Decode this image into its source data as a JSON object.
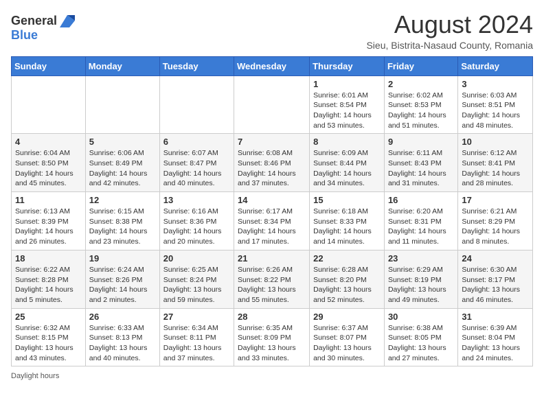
{
  "header": {
    "logo_general": "General",
    "logo_blue": "Blue",
    "main_title": "August 2024",
    "subtitle": "Sieu, Bistrita-Nasaud County, Romania"
  },
  "calendar": {
    "days_of_week": [
      "Sunday",
      "Monday",
      "Tuesday",
      "Wednesday",
      "Thursday",
      "Friday",
      "Saturday"
    ],
    "weeks": [
      [
        {
          "day": "",
          "info": ""
        },
        {
          "day": "",
          "info": ""
        },
        {
          "day": "",
          "info": ""
        },
        {
          "day": "",
          "info": ""
        },
        {
          "day": "1",
          "info": "Sunrise: 6:01 AM\nSunset: 8:54 PM\nDaylight: 14 hours and 53 minutes."
        },
        {
          "day": "2",
          "info": "Sunrise: 6:02 AM\nSunset: 8:53 PM\nDaylight: 14 hours and 51 minutes."
        },
        {
          "day": "3",
          "info": "Sunrise: 6:03 AM\nSunset: 8:51 PM\nDaylight: 14 hours and 48 minutes."
        }
      ],
      [
        {
          "day": "4",
          "info": "Sunrise: 6:04 AM\nSunset: 8:50 PM\nDaylight: 14 hours and 45 minutes."
        },
        {
          "day": "5",
          "info": "Sunrise: 6:06 AM\nSunset: 8:49 PM\nDaylight: 14 hours and 42 minutes."
        },
        {
          "day": "6",
          "info": "Sunrise: 6:07 AM\nSunset: 8:47 PM\nDaylight: 14 hours and 40 minutes."
        },
        {
          "day": "7",
          "info": "Sunrise: 6:08 AM\nSunset: 8:46 PM\nDaylight: 14 hours and 37 minutes."
        },
        {
          "day": "8",
          "info": "Sunrise: 6:09 AM\nSunset: 8:44 PM\nDaylight: 14 hours and 34 minutes."
        },
        {
          "day": "9",
          "info": "Sunrise: 6:11 AM\nSunset: 8:43 PM\nDaylight: 14 hours and 31 minutes."
        },
        {
          "day": "10",
          "info": "Sunrise: 6:12 AM\nSunset: 8:41 PM\nDaylight: 14 hours and 28 minutes."
        }
      ],
      [
        {
          "day": "11",
          "info": "Sunrise: 6:13 AM\nSunset: 8:39 PM\nDaylight: 14 hours and 26 minutes."
        },
        {
          "day": "12",
          "info": "Sunrise: 6:15 AM\nSunset: 8:38 PM\nDaylight: 14 hours and 23 minutes."
        },
        {
          "day": "13",
          "info": "Sunrise: 6:16 AM\nSunset: 8:36 PM\nDaylight: 14 hours and 20 minutes."
        },
        {
          "day": "14",
          "info": "Sunrise: 6:17 AM\nSunset: 8:34 PM\nDaylight: 14 hours and 17 minutes."
        },
        {
          "day": "15",
          "info": "Sunrise: 6:18 AM\nSunset: 8:33 PM\nDaylight: 14 hours and 14 minutes."
        },
        {
          "day": "16",
          "info": "Sunrise: 6:20 AM\nSunset: 8:31 PM\nDaylight: 14 hours and 11 minutes."
        },
        {
          "day": "17",
          "info": "Sunrise: 6:21 AM\nSunset: 8:29 PM\nDaylight: 14 hours and 8 minutes."
        }
      ],
      [
        {
          "day": "18",
          "info": "Sunrise: 6:22 AM\nSunset: 8:28 PM\nDaylight: 14 hours and 5 minutes."
        },
        {
          "day": "19",
          "info": "Sunrise: 6:24 AM\nSunset: 8:26 PM\nDaylight: 14 hours and 2 minutes."
        },
        {
          "day": "20",
          "info": "Sunrise: 6:25 AM\nSunset: 8:24 PM\nDaylight: 13 hours and 59 minutes."
        },
        {
          "day": "21",
          "info": "Sunrise: 6:26 AM\nSunset: 8:22 PM\nDaylight: 13 hours and 55 minutes."
        },
        {
          "day": "22",
          "info": "Sunrise: 6:28 AM\nSunset: 8:20 PM\nDaylight: 13 hours and 52 minutes."
        },
        {
          "day": "23",
          "info": "Sunrise: 6:29 AM\nSunset: 8:19 PM\nDaylight: 13 hours and 49 minutes."
        },
        {
          "day": "24",
          "info": "Sunrise: 6:30 AM\nSunset: 8:17 PM\nDaylight: 13 hours and 46 minutes."
        }
      ],
      [
        {
          "day": "25",
          "info": "Sunrise: 6:32 AM\nSunset: 8:15 PM\nDaylight: 13 hours and 43 minutes."
        },
        {
          "day": "26",
          "info": "Sunrise: 6:33 AM\nSunset: 8:13 PM\nDaylight: 13 hours and 40 minutes."
        },
        {
          "day": "27",
          "info": "Sunrise: 6:34 AM\nSunset: 8:11 PM\nDaylight: 13 hours and 37 minutes."
        },
        {
          "day": "28",
          "info": "Sunrise: 6:35 AM\nSunset: 8:09 PM\nDaylight: 13 hours and 33 minutes."
        },
        {
          "day": "29",
          "info": "Sunrise: 6:37 AM\nSunset: 8:07 PM\nDaylight: 13 hours and 30 minutes."
        },
        {
          "day": "30",
          "info": "Sunrise: 6:38 AM\nSunset: 8:05 PM\nDaylight: 13 hours and 27 minutes."
        },
        {
          "day": "31",
          "info": "Sunrise: 6:39 AM\nSunset: 8:04 PM\nDaylight: 13 hours and 24 minutes."
        }
      ]
    ]
  },
  "footer": {
    "note": "Daylight hours"
  }
}
